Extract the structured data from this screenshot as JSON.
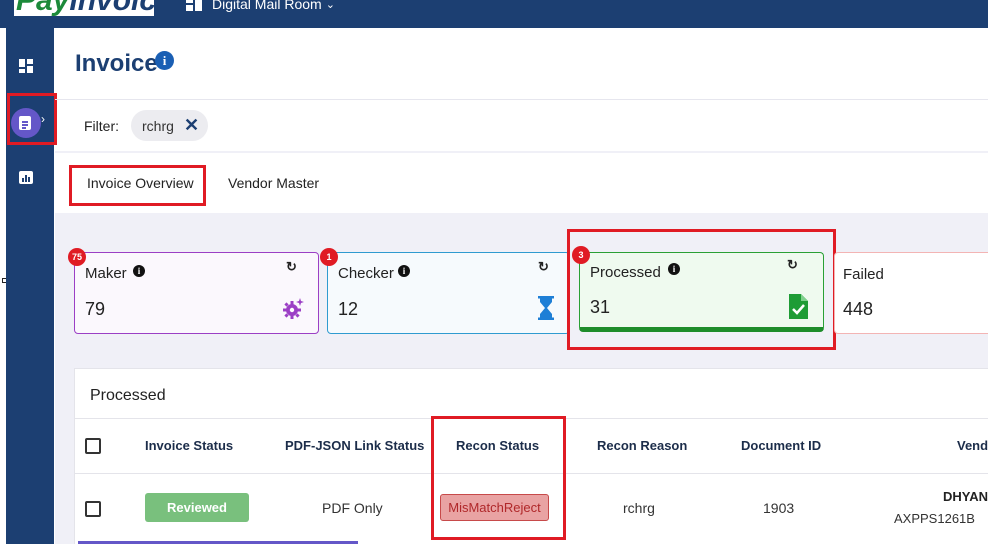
{
  "topbar": {
    "logo_text_part1": "Pay",
    "logo_text_part2": "Invoice",
    "app_switch_label": "Digital Mail Room",
    "app_switch_chevron": "chevron-down-icon"
  },
  "sidebar": {
    "items": [
      {
        "icon": "dashboard-icon"
      },
      {
        "icon": "document-icon",
        "active": true
      },
      {
        "icon": "bar-chart-icon"
      }
    ],
    "active_color": "#6457c8"
  },
  "header": {
    "title": "Invoice",
    "info_glyph": "i"
  },
  "filter": {
    "label": "Filter:",
    "chip_value": "rchrg",
    "chip_close_glyph": "✕"
  },
  "tabs": [
    {
      "label": "Invoice Overview",
      "selected": true
    },
    {
      "label": "Vendor Master",
      "selected": false
    }
  ],
  "cards": {
    "maker": {
      "label": "Maker",
      "value": "79",
      "badge": "75",
      "color": "#9b3fc5"
    },
    "checker": {
      "label": "Checker",
      "value": "12",
      "badge": "1",
      "color": "#2f9bd0"
    },
    "processed": {
      "label": "Processed",
      "value": "31",
      "badge": "3",
      "color": "#1e8c2a"
    },
    "failed": {
      "label": "Failed",
      "value": "448",
      "color": "#f3b4b4"
    },
    "refresh_glyph": "↻",
    "info_glyph": "i"
  },
  "table": {
    "title": "Processed",
    "columns": [
      "Invoice Status",
      "PDF-JSON Link Status",
      "Recon Status",
      "Recon Reason",
      "Document ID",
      "Vend"
    ],
    "rows": [
      {
        "invoice_status": "Reviewed",
        "pdf_json_link_status": "PDF Only",
        "recon_status": "MisMatchReject",
        "recon_reason": "rchrg",
        "document_id": "1903",
        "vendor_name": "DHYAN",
        "vendor_pan": "AXPPS1261B"
      }
    ]
  },
  "colors": {
    "primary": "#1c3f72",
    "highlight_outline": "#e01b24",
    "reviewed": "#79c07d",
    "mismatch": "#e9a3a3"
  }
}
